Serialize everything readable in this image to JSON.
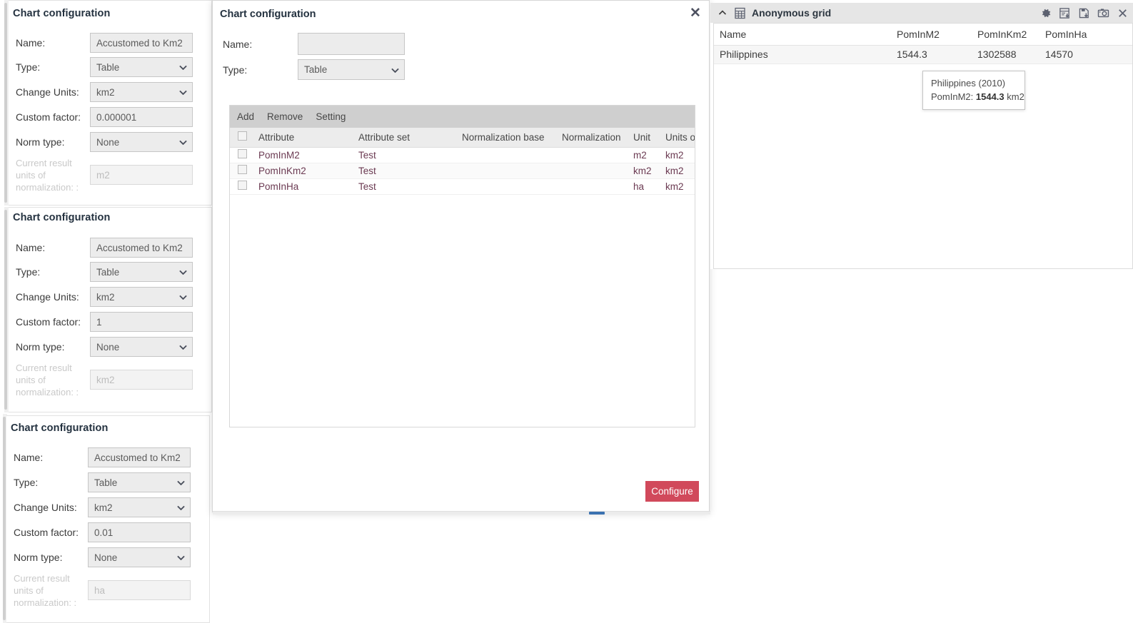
{
  "panels": [
    {
      "title": "Chart configuration",
      "fields": {
        "name_label": "Name:",
        "name_value": "Accustomed to Km2",
        "type_label": "Type:",
        "type_value": "Table",
        "change_units_label": "Change Units:",
        "change_units_value": "km2",
        "custom_factor_label": "Custom factor:",
        "custom_factor_value": "0.000001",
        "norm_type_label": "Norm type:",
        "norm_type_value": "None",
        "current_units_label": "Current result units of normalization: :",
        "current_units_value": "m2"
      }
    },
    {
      "title": "Chart configuration",
      "fields": {
        "name_label": "Name:",
        "name_value": "Accustomed to Km2",
        "type_label": "Type:",
        "type_value": "Table",
        "change_units_label": "Change Units:",
        "change_units_value": "km2",
        "custom_factor_label": "Custom factor:",
        "custom_factor_value": "1",
        "norm_type_label": "Norm type:",
        "norm_type_value": "None",
        "current_units_label": "Current result units of normalization: :",
        "current_units_value": "km2"
      }
    },
    {
      "title": "Chart configuration",
      "fields": {
        "name_label": "Name:",
        "name_value": "Accustomed to Km2",
        "type_label": "Type:",
        "type_value": "Table",
        "change_units_label": "Change Units:",
        "change_units_value": "km2",
        "custom_factor_label": "Custom factor:",
        "custom_factor_value": "0.01",
        "norm_type_label": "Norm type:",
        "norm_type_value": "None",
        "current_units_label": "Current result units of normalization: :",
        "current_units_value": "ha"
      }
    }
  ],
  "modal": {
    "title": "Chart configuration",
    "close_label": "✕",
    "name_label": "Name:",
    "name_value": "",
    "name_placeholder": "",
    "type_label": "Type:",
    "type_value": "Table",
    "toolbar": {
      "add": "Add",
      "remove": "Remove",
      "setting": "Setting"
    },
    "table": {
      "columns": [
        "",
        "Attribute",
        "Attribute set",
        "Normalization base",
        "Normalization",
        "Unit",
        "Units o"
      ],
      "rows": [
        {
          "attribute": "PomInM2",
          "attribute_set": "Test",
          "normalization_base": "",
          "normalization": "",
          "unit": "m2",
          "units_of": "km2",
          "checked": false
        },
        {
          "attribute": "PomInKm2",
          "attribute_set": "Test",
          "normalization_base": "",
          "normalization": "",
          "unit": "km2",
          "units_of": "km2",
          "checked": false
        },
        {
          "attribute": "PomInHa",
          "attribute_set": "Test",
          "normalization_base": "",
          "normalization": "",
          "unit": "ha",
          "units_of": "km2",
          "checked": false
        }
      ]
    },
    "configure_button": "Configure"
  },
  "grid_panel": {
    "title": "Anonymous grid",
    "icons": [
      "collapse-caret-icon",
      "grid-icon",
      "gear-icon",
      "export-report-icon",
      "save-icon",
      "camera-icon",
      "close-icon"
    ],
    "columns": [
      "Name",
      "PomInM2",
      "PomInKm2",
      "PomInHa"
    ],
    "rows": [
      {
        "name": "Philippines",
        "pom_in_m2": "1544.3",
        "pom_in_km2": "1302588",
        "pom_in_ha": "14570"
      }
    ],
    "tooltip": {
      "line1": "Philippines (2010)",
      "label": "PomInM2:",
      "value": "1544.3",
      "unit": "km2"
    }
  },
  "colors": {
    "accent_button": "#d1495b",
    "header_bg": "#e6e6e6",
    "toolbar_bg": "#cfcfcf",
    "field_bg": "#ececec",
    "link_text": "#6b3a52"
  }
}
